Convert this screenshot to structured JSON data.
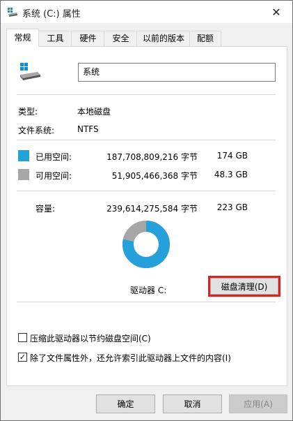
{
  "window": {
    "title": "系统 (C:) 属性",
    "close_glyph": "✕"
  },
  "tabs": [
    {
      "label": "常规",
      "active": true
    },
    {
      "label": "工具",
      "active": false
    },
    {
      "label": "硬件",
      "active": false
    },
    {
      "label": "安全",
      "active": false
    },
    {
      "label": "以前的版本",
      "active": false
    },
    {
      "label": "配额",
      "active": false
    }
  ],
  "general": {
    "drive_name": "系统",
    "type_label": "类型:",
    "type_value": "本地磁盘",
    "fs_label": "文件系统:",
    "fs_value": "NTFS",
    "used": {
      "label": "已用空间:",
      "bytes": "187,708,809,216 字节",
      "size": "174 GB",
      "color": "#26a0da"
    },
    "free": {
      "label": "可用空间:",
      "bytes": "51,905,466,368 字节",
      "size": "48.3 GB",
      "color": "#a6a6a6"
    },
    "capacity": {
      "label": "容量:",
      "bytes": "239,614,275,584 字节",
      "size": "223 GB"
    },
    "used_fraction": 0.7834,
    "drive_label": "驱动器 C:",
    "cleanup_button": "磁盘清理(D)",
    "compress_option": {
      "label": "压缩此驱动器以节约磁盘空间(C)",
      "checked": false
    },
    "index_option": {
      "label": "除了文件属性外，还允许索引此驱动器上文件的内容(I)",
      "checked": true
    }
  },
  "footer": {
    "ok": "确定",
    "cancel": "取消",
    "apply": "应用(A)"
  },
  "icons": {
    "title": "drive-icon",
    "drive": "drive-icon",
    "checkmark": "✓"
  }
}
